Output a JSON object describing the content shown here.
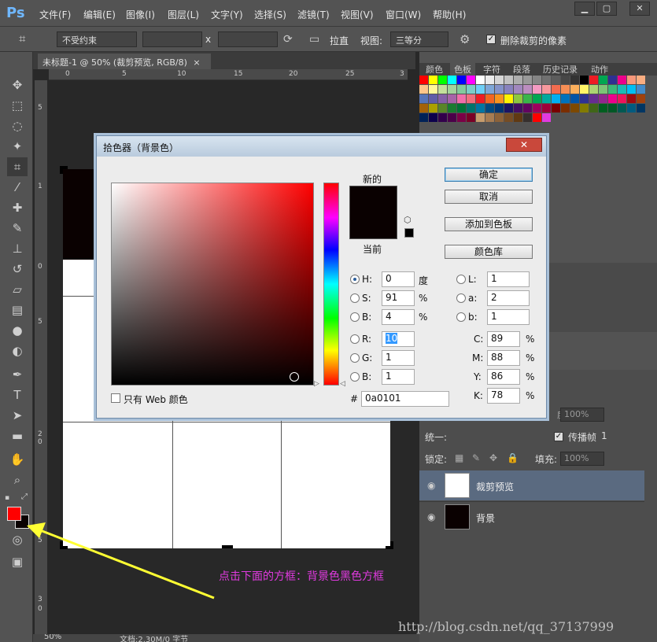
{
  "app": {
    "logo": "Ps",
    "menus": [
      "文件(F)",
      "编辑(E)",
      "图像(I)",
      "图层(L)",
      "文字(Y)",
      "选择(S)",
      "滤镜(T)",
      "视图(V)",
      "窗口(W)",
      "帮助(H)"
    ],
    "win_buttons": [
      "▁",
      "▢",
      "✕"
    ]
  },
  "options": {
    "ratio": "不受约束",
    "x_label": "x",
    "straighten": "拉直",
    "view_label": "视图:",
    "view_value": "三等分",
    "delete_pixels": "删除裁剪的像素"
  },
  "document": {
    "tab": "未标题-1 @ 50% (裁剪预览, RGB/8)",
    "tab_close": "×",
    "ruler_h": [
      "0",
      "5",
      "10",
      "15",
      "20",
      "25",
      "3"
    ],
    "ruler_v": [
      "5",
      "1",
      "0",
      "5",
      "2",
      "0",
      "5",
      "3",
      "0"
    ],
    "zoom": "50%",
    "docinfo": "文档:2.30M/0 字节"
  },
  "panels": {
    "tabs": [
      "颜色",
      "色板",
      "字符",
      "段落",
      "历史记录",
      "动作"
    ],
    "active_tab": "色板",
    "swatch_colors": [
      "#ff0000",
      "#ffff00",
      "#00ff00",
      "#00ffff",
      "#0000ff",
      "#ff00ff",
      "#ffffff",
      "#ebebeb",
      "#d6d6d6",
      "#c2c2c2",
      "#adadad",
      "#999999",
      "#858585",
      "#707070",
      "#5c5c5c",
      "#474747",
      "#333333",
      "#000000",
      "#ed1c24",
      "#00a651",
      "#2e3192",
      "#ec008c",
      "#f7977a",
      "#f9ad81",
      "#fdc68a",
      "#fff79a",
      "#c4df9b",
      "#a3d39c",
      "#82ca9d",
      "#7bcdc8",
      "#6ecff6",
      "#7ea7d8",
      "#8493ca",
      "#8882be",
      "#a187be",
      "#bc8dbf",
      "#f49ac2",
      "#f6989d",
      "#f26c4f",
      "#f68e55",
      "#fbaf5c",
      "#fff467",
      "#acd372",
      "#7cc576",
      "#3bb878",
      "#1abbb4",
      "#00bff3",
      "#438ccb",
      "#5574b9",
      "#605ca8",
      "#855fa8",
      "#a763a8",
      "#f06eaa",
      "#f26d7d",
      "#ed1c24",
      "#f26522",
      "#f7941d",
      "#fff200",
      "#8dc73f",
      "#39b54a",
      "#00a651",
      "#00a99d",
      "#00aeef",
      "#0072bc",
      "#0054a6",
      "#2e3192",
      "#662d91",
      "#92278f",
      "#ec008c",
      "#ed145b",
      "#9e0b0f",
      "#a0410d",
      "#a36209",
      "#aba000",
      "#598527",
      "#197b30",
      "#007236",
      "#00746b",
      "#0076a3",
      "#004a80",
      "#003471",
      "#1b1464",
      "#440e62",
      "#630460",
      "#9e005d",
      "#9e0039",
      "#790000",
      "#7b2e00",
      "#7d4900",
      "#827b00",
      "#406618",
      "#005e20",
      "#005826",
      "#005952",
      "#005b7f",
      "#003663",
      "#002157",
      "#0d004c",
      "#32004b",
      "#4b0049",
      "#7b0046",
      "#7a0026",
      "#c69c6d",
      "#a67c52",
      "#8c6239",
      "#754c24",
      "#603913",
      "#362f2d",
      "#ff0000",
      "#e13ae0"
    ],
    "layer_opacity_label": "度:",
    "layer_opacity": "100%",
    "unify": "统一:",
    "propagate": "传播帧",
    "propagate_val": "1",
    "lock": "锁定:",
    "fill_label": "填充:",
    "fill": "100%",
    "layers": [
      "裁剪预览",
      "背景"
    ]
  },
  "dialog": {
    "title": "拾色器（背景色）",
    "close": "✕",
    "new_label": "新的",
    "current_label": "当前",
    "new_color": "#0a0101",
    "ok": "确定",
    "cancel": "取消",
    "add_swatch": "添加到色板",
    "color_lib": "颜色库",
    "web_only": "只有 Web 颜色",
    "h": {
      "label": "H:",
      "value": "0",
      "unit": "度"
    },
    "s": {
      "label": "S:",
      "value": "91",
      "unit": "%"
    },
    "b": {
      "label": "B:",
      "value": "4",
      "unit": "%"
    },
    "r": {
      "label": "R:",
      "value": "10"
    },
    "g": {
      "label": "G:",
      "value": "1"
    },
    "bl": {
      "label": "B:",
      "value": "1"
    },
    "L": {
      "label": "L:",
      "value": "1"
    },
    "a": {
      "label": "a:",
      "value": "2"
    },
    "bb": {
      "label": "b:",
      "value": "1"
    },
    "c": {
      "label": "C:",
      "value": "89",
      "unit": "%"
    },
    "m": {
      "label": "M:",
      "value": "88",
      "unit": "%"
    },
    "y": {
      "label": "Y:",
      "value": "86",
      "unit": "%"
    },
    "k": {
      "label": "K:",
      "value": "78",
      "unit": "%"
    },
    "hash": "#",
    "hex": "0a0101"
  },
  "annotation": "点击下面的方框：背景色黑色方框",
  "watermark": "http://blog.csdn.net/qq_37137999"
}
